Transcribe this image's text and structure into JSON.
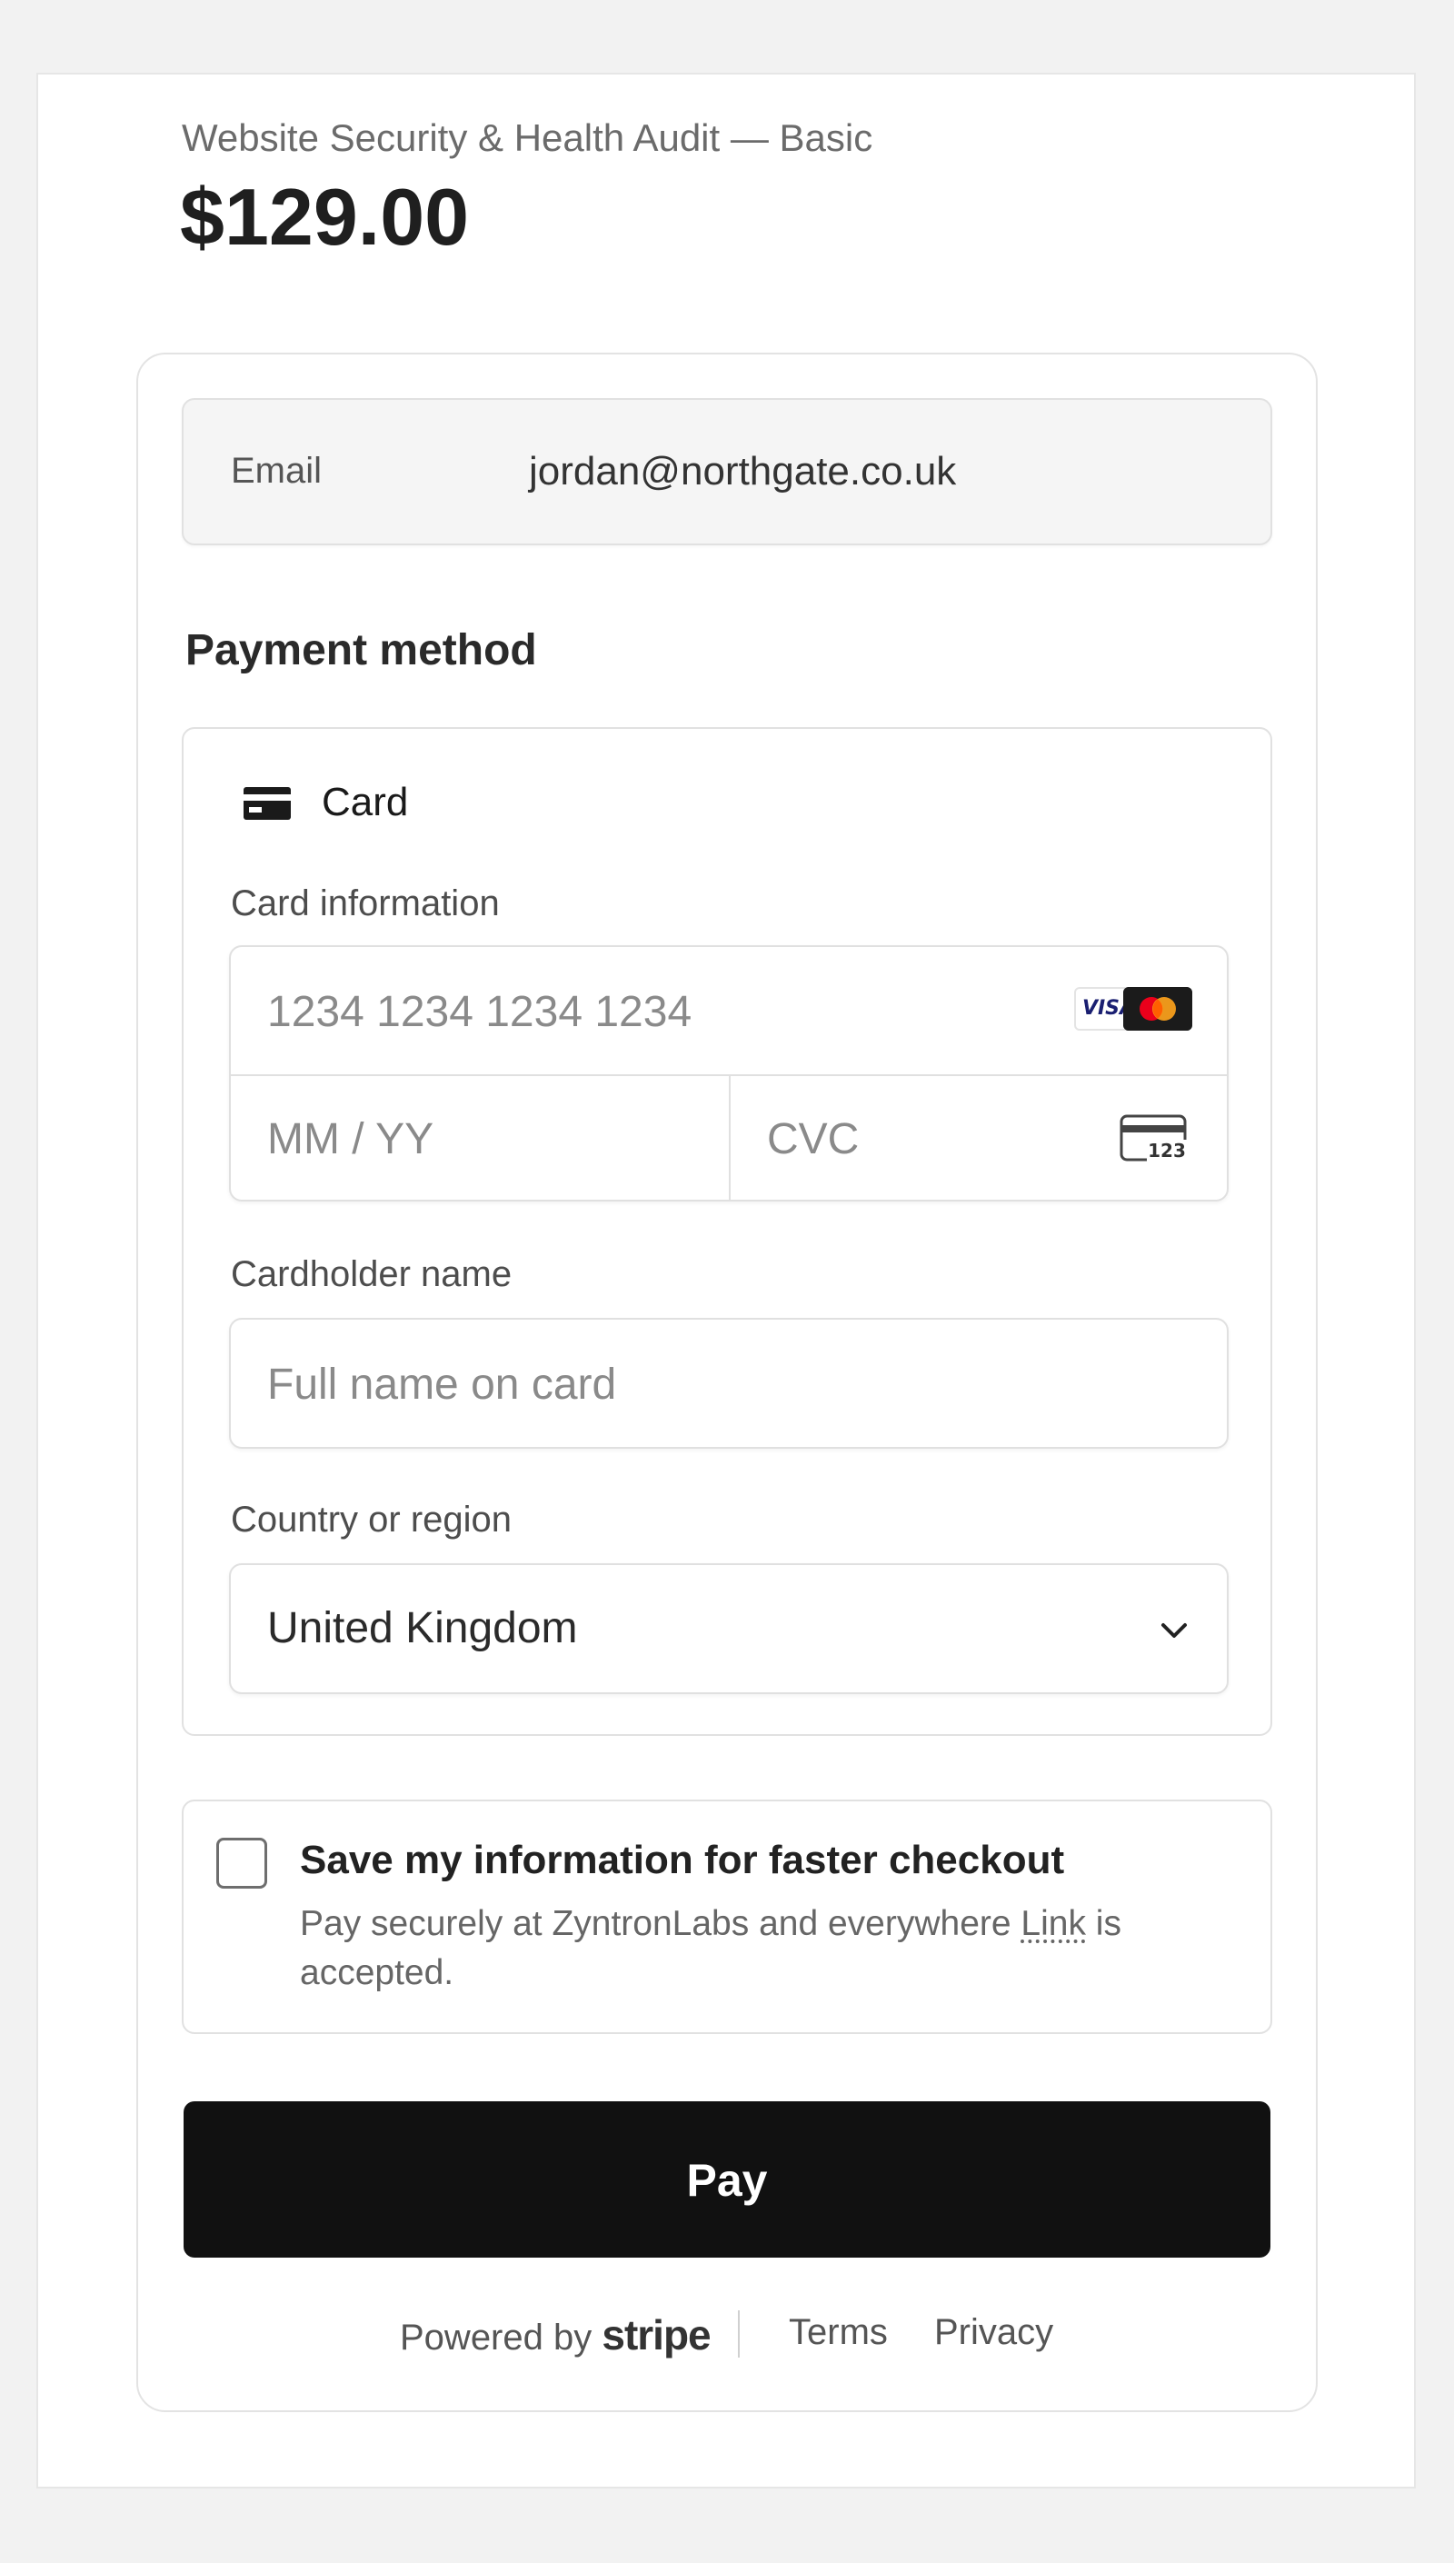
{
  "product": {
    "name": "Website Security & Health Audit — Basic",
    "price": "$129.00"
  },
  "email": {
    "label": "Email",
    "value": "jordan@northgate.co.uk"
  },
  "payment": {
    "section_title": "Payment method",
    "tab_label": "Card",
    "tab_icon": "credit-card-icon",
    "card_info_label": "Card information",
    "card_number_placeholder": "1234 1234 1234 1234",
    "expiry_placeholder": "MM / YY",
    "cvc_placeholder": "CVC",
    "brand_logos": [
      "VISA",
      "mastercard"
    ],
    "cardholder_label": "Cardholder name",
    "cardholder_placeholder": "Full name on card",
    "country_label": "Country or region",
    "country_value": "United Kingdom"
  },
  "save_info": {
    "title": "Save my information for faster checkout",
    "desc_before": "Pay securely at ZyntronLabs and everywhere ",
    "link_text": "Link",
    "desc_after": " is accepted.",
    "checked": false
  },
  "pay_button": {
    "label": "Pay"
  },
  "footer": {
    "powered_by": "Powered by",
    "brand": "stripe",
    "terms": "Terms",
    "privacy": "Privacy"
  },
  "colors": {
    "pay_button_bg": "#111111",
    "page_bg": "#f2f2f2"
  }
}
